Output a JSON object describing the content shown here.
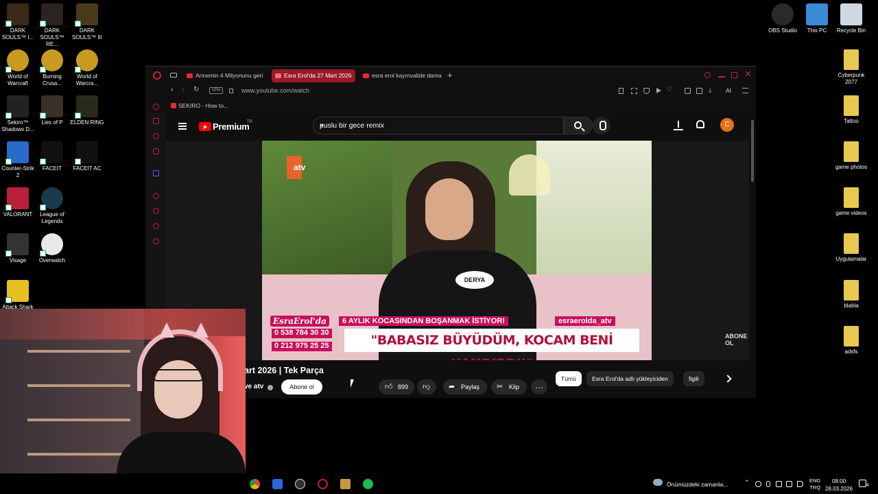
{
  "desktop": {
    "left_icons": [
      {
        "label": "DARK\nSOULS™ I...",
        "color": "#3a2a1a",
        "icon": "dark-souls-icon"
      },
      {
        "label": "DARK\nSOULS™ RE...",
        "color": "#2a2320",
        "icon": "dark-souls-remastered-icon"
      },
      {
        "label": "DARK\nSOULS™ III",
        "color": "#4a3a1a",
        "icon": "dark-souls-3-icon"
      },
      {
        "label": "World of\nWarcraft",
        "color": "#c89a20",
        "icon": "wow-icon"
      },
      {
        "label": "Burning\nCrusa...",
        "color": "#c89a20",
        "icon": "wow-burning-crusade-icon"
      },
      {
        "label": "World of\nWarcra...",
        "color": "#c89a20",
        "icon": "wow-classic-icon"
      },
      {
        "label": "Sekiro™\nShadows D...",
        "color": "#222222",
        "icon": "sekiro-icon"
      },
      {
        "label": "Lies of P",
        "color": "#3a3028",
        "icon": "lies-of-p-icon"
      },
      {
        "label": "ELDEN RING",
        "color": "#2a2a1a",
        "icon": "elden-ring-icon"
      },
      {
        "label": "Counter-Strik\n2",
        "color": "#2a6ac8",
        "icon": "counter-strike-icon"
      },
      {
        "label": "FACEIT",
        "color": "#111111",
        "icon": "faceit-icon"
      },
      {
        "label": "FACEIT AC",
        "color": "#111111",
        "icon": "faceit-ac-icon"
      },
      {
        "label": "VALORANT",
        "color": "#b8203a",
        "icon": "valorant-icon"
      },
      {
        "label": "League of\nLegends",
        "color": "#1a3a4a",
        "icon": "league-of-legends-icon"
      },
      {
        "label": "Visage",
        "color": "#333333",
        "icon": "visage-icon"
      },
      {
        "label": "Overwatch",
        "color": "#e8e8e8",
        "icon": "overwatch-icon"
      },
      {
        "label": "Attack Shark",
        "color": "#e8c020",
        "icon": "attack-shark-icon"
      }
    ],
    "right_icons": [
      {
        "label": "OBS Studio",
        "color": "#2a2a2a",
        "icon": "obs-icon"
      },
      {
        "label": "This PC",
        "color": "#3a8ad8",
        "icon": "this-pc-icon"
      },
      {
        "label": "Recycle Bin",
        "color": "#cfd8e0",
        "icon": "recycle-bin-icon"
      },
      {
        "label": "Cyberpunk\n2077",
        "color": "#e8c850",
        "icon": "folder-icon"
      },
      {
        "label": "Tattoo",
        "color": "#e8c850",
        "icon": "folder-icon"
      },
      {
        "label": "game photos",
        "color": "#e8c850",
        "icon": "folder-icon"
      },
      {
        "label": "game videos",
        "color": "#e8c850",
        "icon": "folder-icon"
      },
      {
        "label": "Uygulamalar",
        "color": "#e8c850",
        "icon": "folder-icon"
      },
      {
        "label": "blabla",
        "color": "#e8c850",
        "icon": "folder-icon"
      },
      {
        "label": "adsfs",
        "color": "#e8c850",
        "icon": "folder-icon"
      }
    ]
  },
  "browser": {
    "tabs": [
      {
        "label": "Annemin 4 Milyonunu geri"
      },
      {
        "label": "Esra Erol'da 27 Mart 2026"
      },
      {
        "label": "esra erol kayınvalide dama"
      }
    ],
    "url": "www.youtube.com/watch",
    "vpn_label": "VPN",
    "ai_label": "AI",
    "bookmark": "SEKIRO - How to..."
  },
  "youtube": {
    "brand": "Premium",
    "region": "TR",
    "search_query": "puslu bir gece remix",
    "avatar_letter": "C",
    "video": {
      "channel_logo": "atv",
      "name_badge": "DERYA",
      "banner_brand": "EsraErol'da",
      "banner_headline": "6 AYLIK KOCASINDAN BOŞANMAK İSTİYOR!",
      "banner_instagram": "esraerolda_atv",
      "phone_1": "0 538 784 30 30",
      "phone_2": "0 212 975 25 25",
      "banner_quote": "\"BABASIZ BÜYÜDÜM, KOCAM BENİ KANDIRDI!\"",
      "corner_text": "ABONE\nOL"
    },
    "title": "art 2026 | Tek Parça",
    "channel": "ve atv",
    "subscribe_label": "Abone ol",
    "likes": "899",
    "share_label": "Paylaş",
    "clip_label": "Klip",
    "chips": [
      "Tümü",
      "Esra Erol'da adlı yükleyiciden",
      "İlgili"
    ]
  },
  "taskbar": {
    "weather_text": "Önümüzdeki zamanla...",
    "lang_top": "ENG",
    "lang_bottom": "TRQ",
    "time": "08:00",
    "date": "28.03.2026",
    "notification_count": "4"
  },
  "colors": {
    "accent": "#c8203a",
    "yt_red": "#ff0000",
    "banner_pink": "#c8105a"
  }
}
